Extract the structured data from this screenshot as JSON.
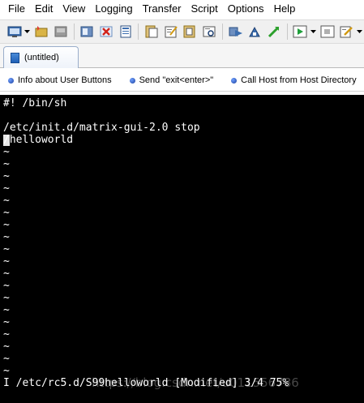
{
  "menubar": {
    "items": [
      "File",
      "Edit",
      "View",
      "Logging",
      "Transfer",
      "Script",
      "Options",
      "Help"
    ]
  },
  "toolbar": {
    "icons": [
      "connect-icon",
      "quick-connect-icon",
      "reconnect-icon",
      "disconnect-icon",
      "close-icon",
      "session-icon",
      "copy-icon",
      "paste-icon",
      "print-icon",
      "find-icon",
      "transfer-icon",
      "sftp-icon",
      "keymap-icon",
      "run-script-icon",
      "stop-script-icon",
      "edit-icon"
    ]
  },
  "tab": {
    "label": "(untitled)"
  },
  "button_bar": {
    "buttons": [
      "Info about User Buttons",
      "Send \"exit<enter>\"",
      "Call Host from Host Directory"
    ]
  },
  "terminal": {
    "lines": [
      "#! /bin/sh",
      "",
      "/etc/init.d/matrix-gui-2.0 stop",
      "/helloworld"
    ],
    "tilde": "~",
    "status": "I /etc/rc5.d/S99helloworld [Modified] 3/4 75%",
    "watermark": "https://blog.csdn.net/u011556786"
  },
  "colors": {
    "terminal_bg": "#000000",
    "terminal_fg": "#ffffff",
    "accent": "#1f5fb5"
  }
}
